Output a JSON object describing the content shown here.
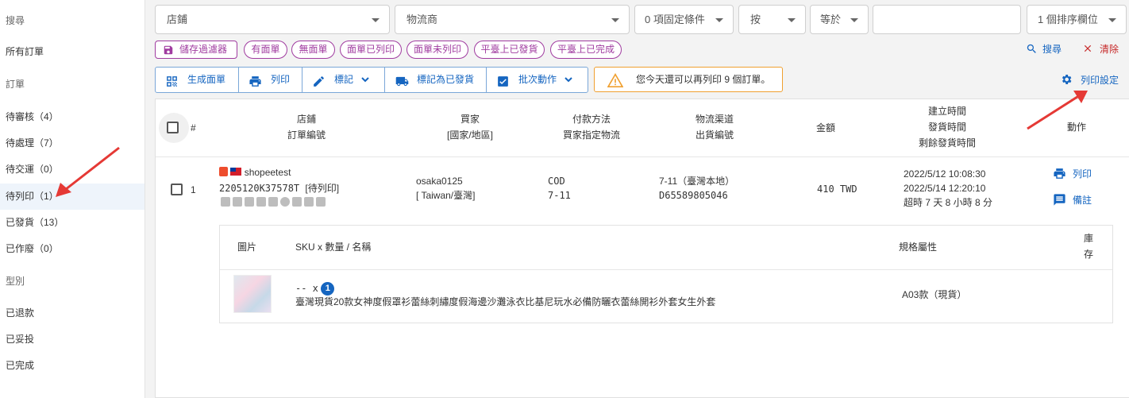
{
  "sidebar": {
    "items": [
      {
        "label": "搜尋",
        "type": "section"
      },
      {
        "label": "所有訂單",
        "type": "item"
      },
      {
        "label": "訂單",
        "type": "section"
      },
      {
        "label": "待審核（4）",
        "type": "item"
      },
      {
        "label": "待處理（7）",
        "type": "item"
      },
      {
        "label": "待交運（0）",
        "type": "item"
      },
      {
        "label": "待列印（1）",
        "type": "item",
        "active": true
      },
      {
        "label": "已發貨（13）",
        "type": "item"
      },
      {
        "label": "已作廢（0）",
        "type": "item"
      },
      {
        "label": "型別",
        "type": "section"
      },
      {
        "label": "已退款",
        "type": "item"
      },
      {
        "label": "已妥投",
        "type": "item"
      },
      {
        "label": "已完成",
        "type": "item"
      }
    ]
  },
  "filters": {
    "shop": "店鋪",
    "logistics": "物流商",
    "fixed_conditions": "0 項固定條件",
    "by": "按",
    "equals": "等於",
    "value": "",
    "sort_fields": "1 個排序欄位"
  },
  "chips": {
    "save_filter": "儲存過濾器",
    "items": [
      "有面單",
      "無面單",
      "面單已列印",
      "面單未列印",
      "平臺上已發貨",
      "平臺上已完成"
    ]
  },
  "actions": {
    "search": "搜尋",
    "clear": "清除",
    "print_settings": "列印設定"
  },
  "toolbar": {
    "generate_label": "生成面單",
    "print": "列印",
    "mark": "標記",
    "mark_shipped": "標記為已發貨",
    "batch": "批次動作"
  },
  "warning": "您今天還可以再列印 9 個訂單。",
  "table": {
    "headers": {
      "index": "#",
      "shop": "店鋪",
      "order_no": "訂單編號",
      "buyer": "買家",
      "country": "[國家/地區]",
      "payment": "付款方法",
      "buyer_logistics": "買家指定物流",
      "channel": "物流渠道",
      "shipping_no": "出貨編號",
      "amount": "金額",
      "created": "建立時間",
      "shipped": "發貨時間",
      "remaining": "剩餘發貨時間",
      "action": "動作"
    },
    "rows": [
      {
        "index": "1",
        "shop": "shopeetest",
        "order_no": "2205120K37578T",
        "status_tag": "[待列印]",
        "buyer": "osaka0125",
        "country": "[ Taiwan/臺灣]",
        "payment": "COD",
        "buyer_logistics": "7-11",
        "channel": "7-11（臺灣本地）",
        "shipping_no": "D65589805046",
        "amount": "410 TWD",
        "created": "2022/5/12 10:08:30",
        "shipped": "2022/5/14 12:20:10",
        "remaining": "超時 7 天 8 小時 8 分",
        "act_print": "列印",
        "act_note": "備註"
      }
    ]
  },
  "items_table": {
    "headers": {
      "image": "圖片",
      "sku": "SKU x 數量 / 名稱",
      "spec": "規格屬性",
      "stock_1": "庫",
      "stock_2": "存"
    },
    "items": [
      {
        "sku": "-- x",
        "qty": "1",
        "name": "臺灣現貨20款女神度假罩衫蕾絲刺繡度假海邊沙灘泳衣比基尼玩水必備防曬衣蕾絲開衫外套女生外套",
        "spec": "A03款（現貨）"
      }
    ]
  },
  "colors": {
    "primary": "#1565c0",
    "chip": "#a03ca0",
    "warn_border": "#f0a030",
    "arrow": "#e53935",
    "clear": "#c62828"
  }
}
